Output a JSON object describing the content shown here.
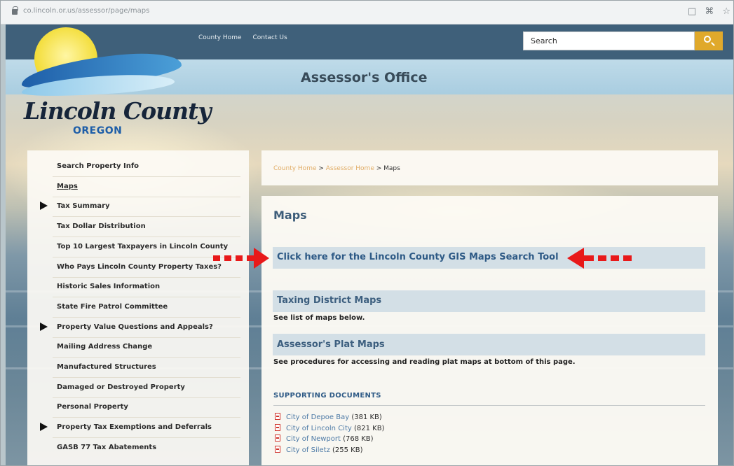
{
  "browser": {
    "url": "co.lincoln.or.us/assessor/page/maps"
  },
  "header": {
    "nav": [
      "County Home",
      "Contact Us"
    ],
    "search_placeholder": "Search"
  },
  "banner": {
    "office_title": "Assessor's Office",
    "logo_name": "Lincoln County",
    "logo_state": "OREGON"
  },
  "sidebar": {
    "items": [
      {
        "label": "Search Property Info",
        "has_arrow": false
      },
      {
        "label": "Maps",
        "has_arrow": false,
        "active": true
      },
      {
        "label": "Tax Summary",
        "has_arrow": true
      },
      {
        "label": "Tax Dollar Distribution",
        "has_arrow": false
      },
      {
        "label": "Top 10 Largest Taxpayers in Lincoln County",
        "has_arrow": false
      },
      {
        "label": "Who Pays Lincoln County Property Taxes?",
        "has_arrow": false
      },
      {
        "label": "Historic Sales Information",
        "has_arrow": false
      },
      {
        "label": "State Fire Patrol Committee",
        "has_arrow": false
      },
      {
        "label": "Property Value Questions and Appeals?",
        "has_arrow": true
      },
      {
        "label": "Mailing Address Change",
        "has_arrow": false
      },
      {
        "label": "Manufactured Structures",
        "has_arrow": false
      },
      {
        "label": "Damaged or Destroyed Property",
        "has_arrow": false
      },
      {
        "label": "Personal Property",
        "has_arrow": false
      },
      {
        "label": "Property Tax Exemptions and Deferrals",
        "has_arrow": true
      },
      {
        "label": "GASB 77 Tax Abatements",
        "has_arrow": false
      }
    ]
  },
  "breadcrumb": {
    "county_home": "County Home",
    "sep1": " > ",
    "assessor_home": "Assessor Home",
    "sep2": " > ",
    "current": "Maps"
  },
  "main": {
    "title": "Maps",
    "gis_link": "Click here for the Lincoln County GIS Maps Search Tool",
    "taxing_heading": "Taxing District Maps",
    "taxing_text": "See list of maps below.",
    "plat_heading": "Assessor's Plat Maps",
    "plat_text": "See procedures for accessing and reading plat maps at bottom of this page.",
    "docs_heading": "SUPPORTING DOCUMENTS",
    "documents": [
      {
        "name": "City of Depoe Bay",
        "size": " (381 KB)"
      },
      {
        "name": "City of Lincoln City",
        "size": " (821 KB)"
      },
      {
        "name": "City of Newport",
        "size": " (768 KB)"
      },
      {
        "name": "City of Siletz",
        "size": " (255 KB)"
      }
    ]
  },
  "colors": {
    "header_navy": "#3f607a",
    "search_button": "#e0a92b",
    "title_band": "#bfdbe9",
    "link_blue": "#2e5a86",
    "annotation_red": "#e8191a"
  }
}
